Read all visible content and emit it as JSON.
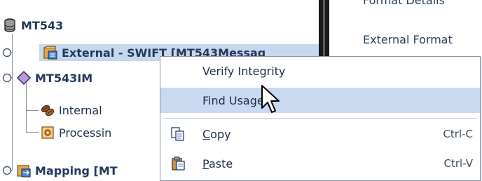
{
  "tree": {
    "root": {
      "label": "MT543",
      "icon": "database-icon"
    },
    "items": [
      {
        "label": "External - SWIFT [MT543Messag",
        "icon": "external-format-icon",
        "selected": true
      },
      {
        "label": "MT543IM",
        "icon": "diamond-icon"
      },
      {
        "label": "Internal",
        "icon": "beans-icon"
      },
      {
        "label": "Processin",
        "icon": "processing-icon"
      },
      {
        "label": "Mapping [MT",
        "icon": "mapping-icon"
      }
    ]
  },
  "right_pane": {
    "header_partial": "Format Details",
    "external_format_label": "External Format"
  },
  "context_menu": {
    "items": [
      {
        "label": "Verify Integrity",
        "mnemonic": "",
        "shortcut": ""
      },
      {
        "label": "Find Usage",
        "mnemonic": "",
        "shortcut": "",
        "highlighted": true
      },
      {
        "label_mnemonic": "C",
        "label_rest": "opy",
        "shortcut": "Ctrl-C",
        "icon": "copy-icon"
      },
      {
        "label_mnemonic": "P",
        "label_rest": "aste",
        "shortcut": "Ctrl-V",
        "icon": "paste-icon"
      }
    ]
  },
  "colors": {
    "selection": "#c7d8ee",
    "menu_highlight": "#c9d9ef",
    "splitter": "#1a1a1a",
    "text": "#1d2f4a"
  }
}
